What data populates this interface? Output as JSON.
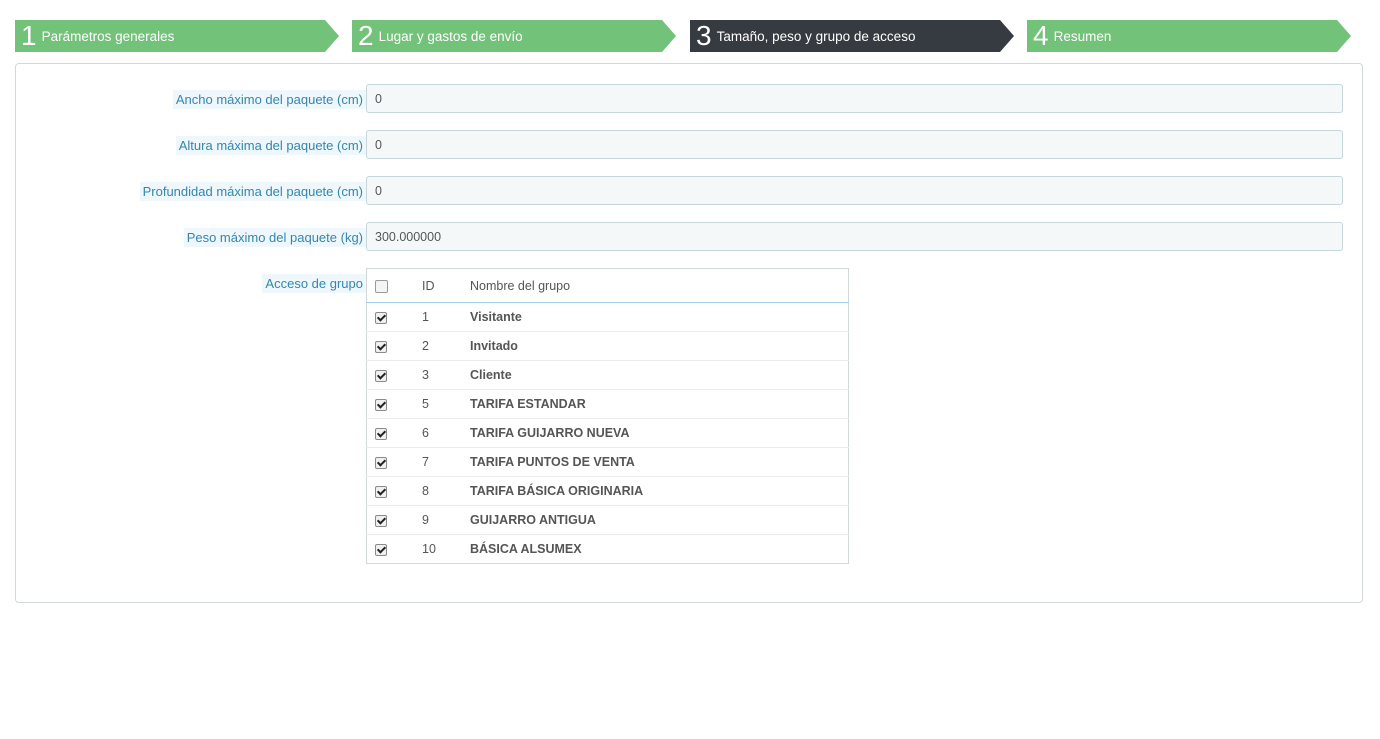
{
  "wizard": {
    "steps": [
      {
        "number": "1",
        "label": "Parámetros generales",
        "active": false
      },
      {
        "number": "2",
        "label": "Lugar y gastos de envío",
        "active": false
      },
      {
        "number": "3",
        "label": "Tamaño, peso y grupo de acceso",
        "active": true
      },
      {
        "number": "4",
        "label": "Resumen",
        "active": false
      }
    ]
  },
  "form": {
    "max_width": {
      "label": "Ancho máximo del paquete (cm)",
      "value": "0"
    },
    "max_height": {
      "label": "Altura máxima del paquete (cm)",
      "value": "0"
    },
    "max_depth": {
      "label": "Profundidad máxima del paquete (cm)",
      "value": "0"
    },
    "max_weight": {
      "label": "Peso máximo del paquete (kg)",
      "value": "300.000000"
    },
    "group_access": {
      "label": "Acceso de grupo",
      "columns": {
        "id": "ID",
        "name": "Nombre del grupo"
      },
      "groups": [
        {
          "id": "1",
          "name": "Visitante",
          "checked": true
        },
        {
          "id": "2",
          "name": "Invitado",
          "checked": true
        },
        {
          "id": "3",
          "name": "Cliente",
          "checked": true
        },
        {
          "id": "5",
          "name": "TARIFA ESTANDAR",
          "checked": true
        },
        {
          "id": "6",
          "name": "TARIFA GUIJARRO NUEVA",
          "checked": true
        },
        {
          "id": "7",
          "name": "TARIFA PUNTOS DE VENTA",
          "checked": true
        },
        {
          "id": "8",
          "name": "TARIFA BÁSICA ORIGINARIA",
          "checked": true
        },
        {
          "id": "9",
          "name": "GUIJARRO ANTIGUA",
          "checked": true
        },
        {
          "id": "10",
          "name": "BÁSICA ALSUMEX",
          "checked": true
        }
      ]
    }
  },
  "colors": {
    "step_done": "#72c279",
    "step_active": "#363a41",
    "label_text": "#3586ae",
    "input_bg": "#f5f8f9"
  }
}
